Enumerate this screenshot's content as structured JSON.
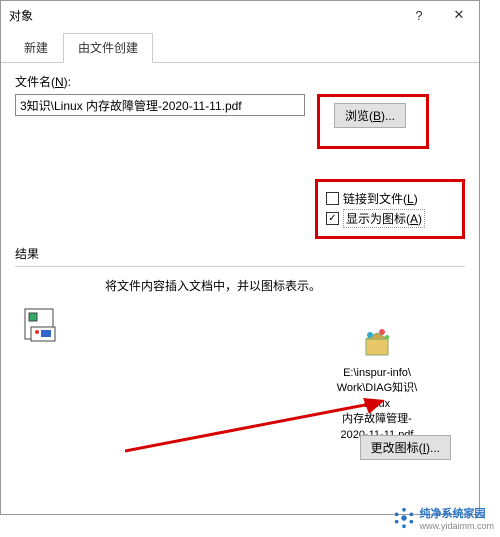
{
  "titlebar": {
    "title": "对象",
    "help": "?",
    "close": "✕"
  },
  "tabs": {
    "t0": "新建",
    "t1": "由文件创建"
  },
  "file": {
    "label_pre": "文件名(",
    "label_u": "N",
    "label_post": "):",
    "value": "3知识\\Linux 内存故障管理-2020-11-11.pdf",
    "browse_pre": "浏览(",
    "browse_u": "B",
    "browse_post": ")..."
  },
  "options": {
    "link_pre": "链接到文件(",
    "link_u": "L",
    "link_post": ")",
    "icon_pre": "显示为图标(",
    "icon_u": "A",
    "icon_post": ")",
    "checkmark": "✓"
  },
  "result": {
    "label": "结果",
    "text": "将文件内容插入文档中，并以图标表示。",
    "path_l1": "E:\\inspur-info\\",
    "path_l2": "Work\\DIAG知识\\",
    "path_l3": "Linux",
    "path_l4": "内存故障管理-",
    "path_l5": "2020-11-11.pdf",
    "change_pre": "更改图标(",
    "change_u": "I",
    "change_post": ")..."
  },
  "watermark": {
    "brand": "纯净系统家园",
    "url": "www.yidaimm.com"
  }
}
